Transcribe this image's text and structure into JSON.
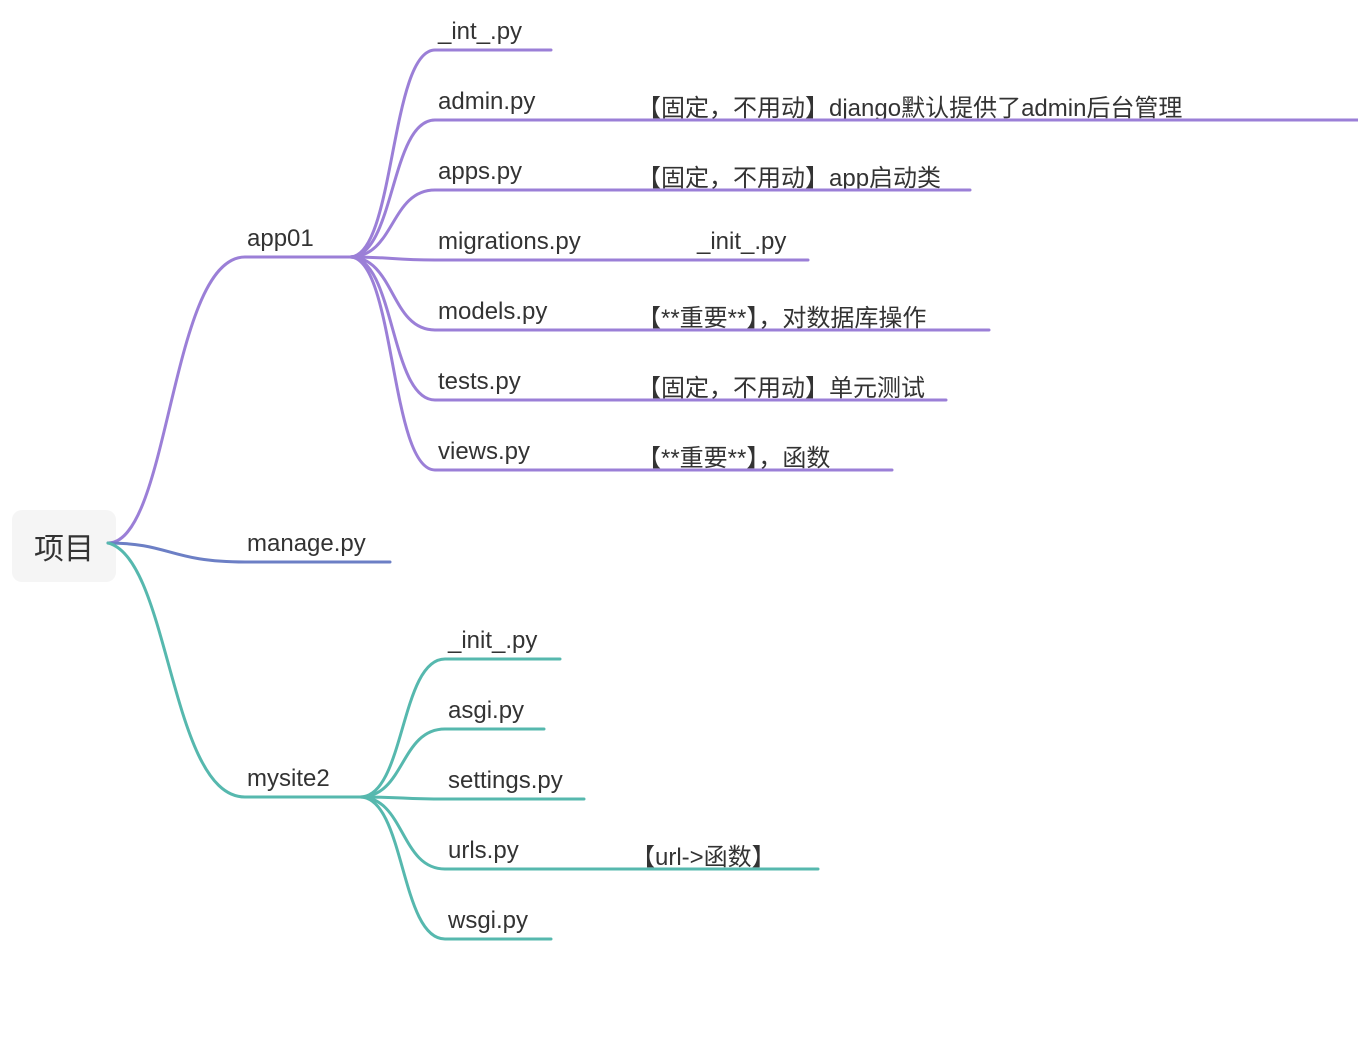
{
  "root": "项目",
  "branches": {
    "app01": {
      "label": "app01",
      "color": "#9b7fd7",
      "children": [
        {
          "label": "_int_.py",
          "note": ""
        },
        {
          "label": "admin.py",
          "note": "【固定，不用动】django默认提供了admin后台管理"
        },
        {
          "label": "apps.py",
          "note": "【固定，不用动】app启动类"
        },
        {
          "label": "migrations.py",
          "note": "_init_.py"
        },
        {
          "label": "models.py",
          "note": "【**重要**】，对数据库操作"
        },
        {
          "label": "tests.py",
          "note": "【固定，不用动】单元测试"
        },
        {
          "label": "views.py",
          "note": "【**重要**】，函数"
        }
      ]
    },
    "manage": {
      "label": "manage.py",
      "color": "#6c7fc5"
    },
    "mysite2": {
      "label": "mysite2",
      "color": "#56b8ae",
      "children": [
        {
          "label": "_init_.py",
          "note": ""
        },
        {
          "label": "asgi.py",
          "note": ""
        },
        {
          "label": "settings.py",
          "note": ""
        },
        {
          "label": "urls.py",
          "note": "【url->函数】"
        },
        {
          "label": "wsgi.py",
          "note": ""
        }
      ]
    }
  },
  "chart_data": {
    "type": "mindmap",
    "root": "项目",
    "nodes": [
      {
        "id": "root",
        "label": "项目",
        "parent": null
      },
      {
        "id": "app01",
        "label": "app01",
        "parent": "root",
        "color": "#9b7fd7"
      },
      {
        "id": "manage",
        "label": "manage.py",
        "parent": "root",
        "color": "#6c7fc5"
      },
      {
        "id": "mysite2",
        "label": "mysite2",
        "parent": "root",
        "color": "#56b8ae"
      },
      {
        "id": "int_py",
        "label": "_int_.py",
        "parent": "app01"
      },
      {
        "id": "admin_py",
        "label": "admin.py",
        "parent": "app01",
        "note": "【固定，不用动】django默认提供了admin后台管理"
      },
      {
        "id": "apps_py",
        "label": "apps.py",
        "parent": "app01",
        "note": "【固定，不用动】app启动类"
      },
      {
        "id": "migrations_py",
        "label": "migrations.py",
        "parent": "app01"
      },
      {
        "id": "init2_py",
        "label": "_init_.py",
        "parent": "migrations_py"
      },
      {
        "id": "models_py",
        "label": "models.py",
        "parent": "app01",
        "note": "【**重要**】，对数据库操作"
      },
      {
        "id": "tests_py",
        "label": "tests.py",
        "parent": "app01",
        "note": "【固定，不用动】单元测试"
      },
      {
        "id": "views_py",
        "label": "views.py",
        "parent": "app01",
        "note": "【**重要**】，函数"
      },
      {
        "id": "init3_py",
        "label": "_init_.py",
        "parent": "mysite2"
      },
      {
        "id": "asgi_py",
        "label": "asgi.py",
        "parent": "mysite2"
      },
      {
        "id": "settings_py",
        "label": "settings.py",
        "parent": "mysite2"
      },
      {
        "id": "urls_py",
        "label": "urls.py",
        "parent": "mysite2",
        "note": "【url->函数】"
      },
      {
        "id": "wsgi_py",
        "label": "wsgi.py",
        "parent": "mysite2"
      }
    ]
  }
}
